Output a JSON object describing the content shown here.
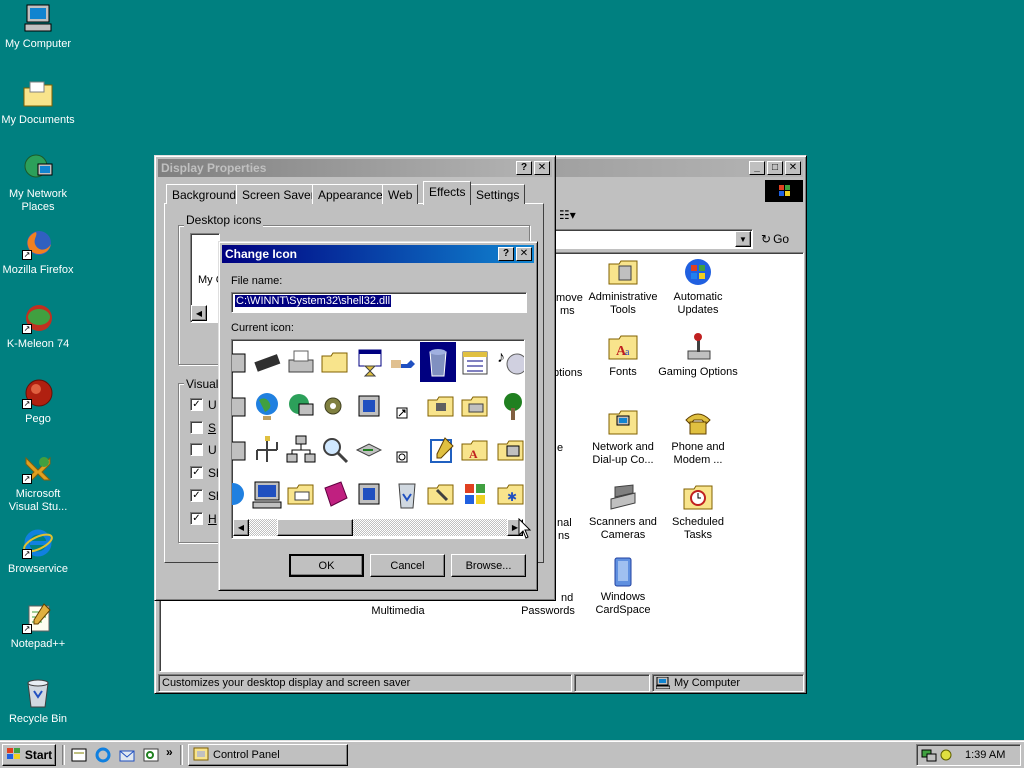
{
  "desktop": {
    "icons": [
      {
        "label": "My Computer",
        "icon": "computer-icon"
      },
      {
        "label": "My Documents",
        "icon": "folder-icon"
      },
      {
        "label": "My Network Places",
        "icon": "network-icon"
      },
      {
        "label": "Mozilla Firefox",
        "icon": "firefox-icon"
      },
      {
        "label": "K-Meleon 74",
        "icon": "kmeleon-icon"
      },
      {
        "label": "Pego",
        "icon": "pego-icon"
      },
      {
        "label": "Microsoft Visual Stu...",
        "icon": "visual-studio-icon"
      },
      {
        "label": "Browservice",
        "icon": "ie-icon"
      },
      {
        "label": "Notepad++",
        "icon": "notepad-icon"
      },
      {
        "label": "Recycle Bin",
        "icon": "recycle-bin-icon"
      }
    ]
  },
  "control_panel": {
    "go_label": "Go",
    "items": [
      {
        "label": "Administrative Tools",
        "icon": "admin-tools-icon"
      },
      {
        "label": "Automatic Updates",
        "icon": "auto-updates-icon"
      },
      {
        "label": "Fonts",
        "icon": "fonts-icon"
      },
      {
        "label": "Gaming Options",
        "icon": "joystick-icon"
      },
      {
        "label": "Network and Dial-up Co...",
        "icon": "network-dialup-icon"
      },
      {
        "label": "Phone and Modem ...",
        "icon": "phone-icon"
      },
      {
        "label": "Scanners and Cameras",
        "icon": "scanner-icon"
      },
      {
        "label": "Scheduled Tasks",
        "icon": "scheduled-tasks-icon"
      },
      {
        "label": "Multimedia",
        "icon": "multimedia-icon"
      },
      {
        "label": "Passwords",
        "icon": "passwords-icon"
      },
      {
        "label": "Windows CardSpace",
        "icon": "cardspace-icon"
      }
    ],
    "partial": [
      "move",
      "ms",
      "ptions",
      "e",
      "nal",
      "ns",
      "nd"
    ],
    "status_left": "Customizes your desktop display and screen saver",
    "status_right": "My Computer"
  },
  "display_properties": {
    "title": "Display Properties",
    "tabs": [
      "Background",
      "Screen Saver",
      "Appearance",
      "Web",
      "Effects",
      "Settings"
    ],
    "active_tab": "Effects",
    "desktop_icons_legend": "Desktop icons",
    "desktop_icons_partial": "My C",
    "visual_legend": "Visual",
    "checkboxes": [
      {
        "label": "U",
        "checked": true
      },
      {
        "label": "S",
        "checked": false
      },
      {
        "label": "U",
        "checked": false
      },
      {
        "label": "Sh",
        "checked": true
      },
      {
        "label": "Sh",
        "checked": true
      },
      {
        "label": "H",
        "checked": true
      }
    ]
  },
  "change_icon": {
    "title": "Change Icon",
    "file_name_label": "File name:",
    "file_name_value": "C:\\WINNT\\System32\\shell32.dll",
    "current_icon_label": "Current icon:",
    "ok_label": "OK",
    "cancel_label": "Cancel",
    "browse_label": "Browse..."
  },
  "taskbar": {
    "start_label": "Start",
    "task_label": "Control Panel",
    "time": "1:39 AM"
  },
  "colors": {
    "desktop": "#008080",
    "active_title": "#000080",
    "inactive_title": "#808080"
  }
}
